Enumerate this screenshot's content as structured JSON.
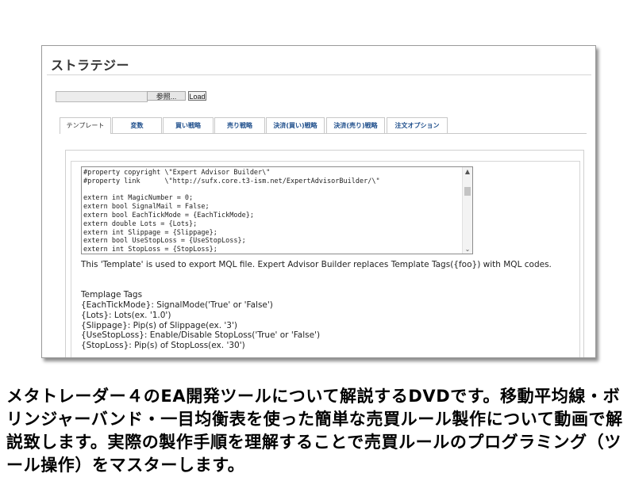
{
  "page": {
    "title": "ストラテジー"
  },
  "file": {
    "browse_label": "参照...",
    "load_label": "Load"
  },
  "tabs": [
    {
      "label": "テンプレート",
      "active": true
    },
    {
      "label": "変数"
    },
    {
      "label": "買い戦略"
    },
    {
      "label": "売り戦略"
    },
    {
      "label": "決済(買い)戦略"
    },
    {
      "label": "決済(売り)戦略"
    },
    {
      "label": "注文オプション"
    }
  ],
  "template": {
    "code": "#property copyright \\\"Expert Advisor Builder\\\"\n#property link      \\\"http://sufx.core.t3-ism.net/ExpertAdvisorBuilder/\\\"\n\nextern int MagicNumber = 0;\nextern bool SignalMail = False;\nextern bool EachTickMode = {EachTickMode};\nextern double Lots = {Lots};\nextern int Slippage = {Slippage};\nextern bool UseStopLoss = {UseStopLoss};\nextern int StopLoss = {StopLoss};",
    "description": "This 'Template' is used to export MQL file. Expert Advisor Builder replaces Template Tags({foo}) with MQL codes.",
    "tags_title": "Templage Tags",
    "tags": [
      "{EachTickMode}: SignalMode('True' or 'False')",
      "{Lots}: Lots(ex. '1.0')",
      "{Slippage}: Pip(s) of Slippage(ex. '3')",
      "{UseStopLoss}: Enable/Disable StopLoss('True' or 'False')",
      "{StopLoss}: Pip(s) of StopLoss(ex. '30')"
    ]
  },
  "caption": "メタトレーダー４のEA開発ツールについて解説するDVDです。移動平均線・ボリンジャーバンド・一目均衡表を使った簡単な売買ルール製作について動画で解説致します。実際の製作手順を理解することで売買ルールのプログラミング（ツール操作）をマスターします。",
  "icons": {
    "scroll_up": "chevron-up-icon",
    "scroll_down": "chevron-down-icon"
  },
  "colors": {
    "tab_text": "#1f4f8c",
    "border": "#c8c8c8"
  }
}
